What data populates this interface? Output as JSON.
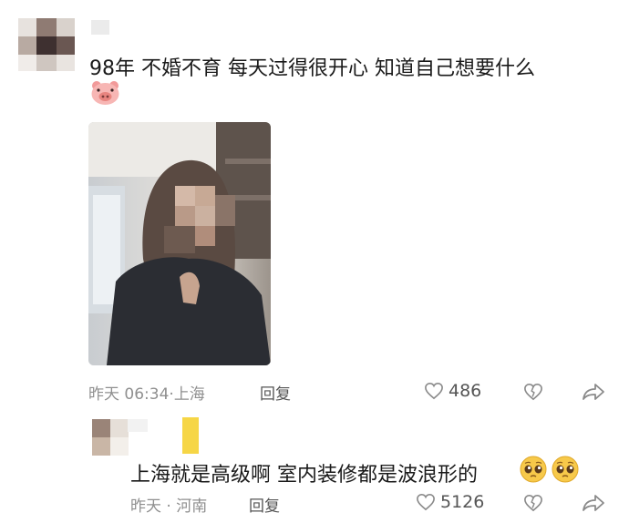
{
  "comments": [
    {
      "text": "98年 不婚不育 每天过得很开心 知道自己想要什么",
      "emoji_icon": "pig-face-icon",
      "time": "昨天 06:34",
      "location": "上海",
      "reply_label": "回复",
      "likes": "486",
      "has_photo": true
    },
    {
      "text": "上海就是高级啊 室内装修都是波浪形的",
      "emoji_icons": [
        "pleading-face-icon",
        "pleading-face-icon"
      ],
      "time": "昨天",
      "location": "河南",
      "reply_label": "回复",
      "likes": "5126"
    }
  ],
  "colors": {
    "meta_text": "#8f8f8f",
    "main_text": "#1a1a1a",
    "icon_gray": "#8a8a8a",
    "emoji_yellow": "#f7c94a",
    "pig_pink": "#f4a7a7"
  }
}
